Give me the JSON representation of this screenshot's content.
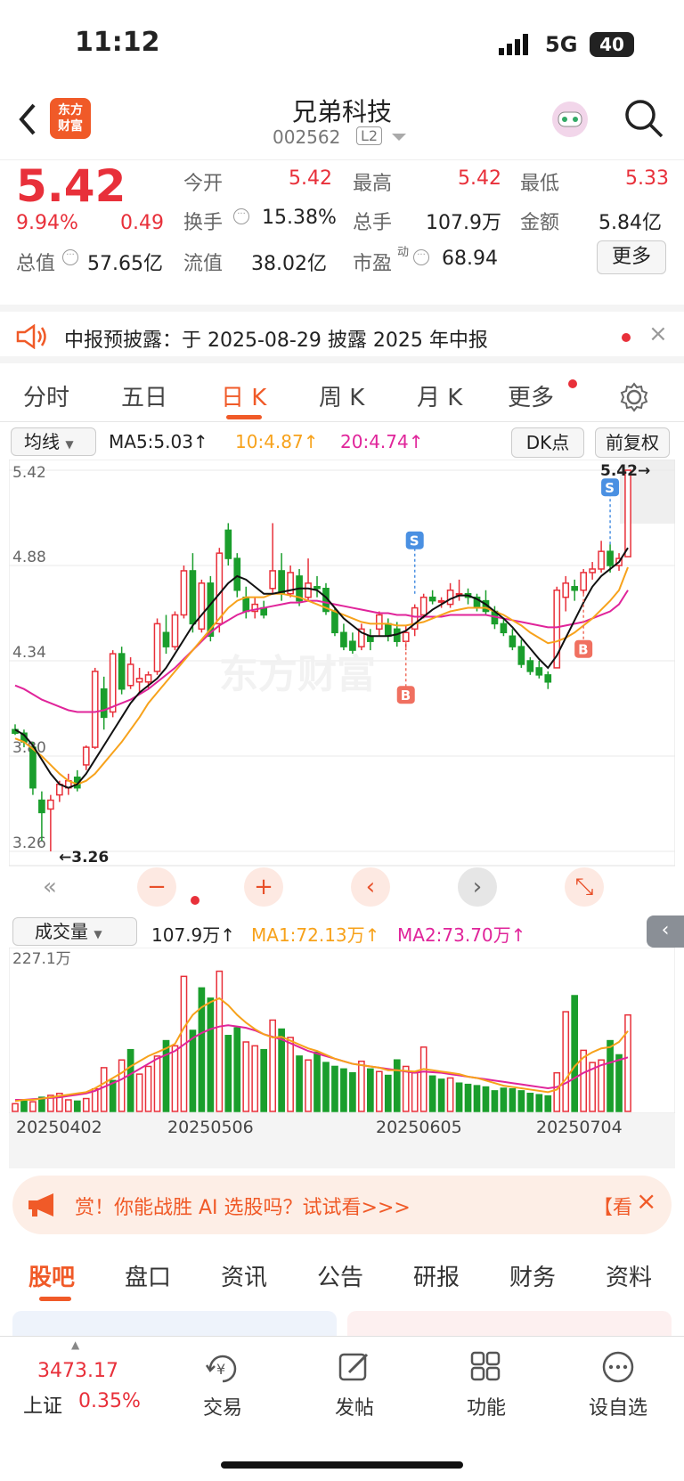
{
  "status_bar": {
    "time": "11:12",
    "network": "5G",
    "battery": "40"
  },
  "header": {
    "logo_line1": "东方",
    "logo_line2": "财富",
    "stock_name": "兄弟科技",
    "stock_code": "002562",
    "level_badge": "L2"
  },
  "quote": {
    "price": "5.42",
    "change_pct": "9.94%",
    "change": "0.49",
    "open_label": "今开",
    "open": "5.42",
    "high_label": "最高",
    "high": "5.42",
    "low_label": "最低",
    "low": "5.33",
    "turnover_label": "换手",
    "turnover": "15.38%",
    "volume_label": "总手",
    "volume": "107.9万",
    "amount_label": "金额",
    "amount": "5.84亿",
    "mktcap_label": "总值",
    "mktcap": "57.65亿",
    "float_label": "流值",
    "float": "38.02亿",
    "pe_label": "市盈",
    "pe_sup": "动",
    "pe": "68.94",
    "more_button": "更多"
  },
  "notice": {
    "text": "中报预披露：于 2025-08-29 披露 2025 年中报"
  },
  "period_tabs": [
    "分时",
    "五日",
    "日 K",
    "周 K",
    "月 K",
    "更多"
  ],
  "active_tab": "日 K",
  "indicator_bar": {
    "dropdown": "均线",
    "ma5": "MA5:5.03↑",
    "ma10": "10:4.87↑",
    "ma20": "20:4.74↑",
    "dk_button": "DK点",
    "fq_button": "前复权"
  },
  "chart_data": {
    "type": "candlestick",
    "y_ticks": [
      "5.42",
      "4.88",
      "4.34",
      "3.80",
      "3.26"
    ],
    "ylim": [
      3.26,
      5.42
    ],
    "max_label": "5.42→",
    "min_label": "←3.26",
    "watermark": "东方财富",
    "signals": [
      "S",
      "S",
      "B",
      "B"
    ],
    "candles": [
      [
        3.95,
        3.98,
        3.92,
        3.93
      ],
      [
        3.93,
        3.95,
        3.85,
        3.88
      ],
      [
        3.85,
        3.88,
        3.58,
        3.62
      ],
      [
        3.55,
        3.6,
        3.32,
        3.48
      ],
      [
        3.5,
        3.58,
        3.26,
        3.55
      ],
      [
        3.58,
        3.66,
        3.54,
        3.64
      ],
      [
        3.62,
        3.7,
        3.58,
        3.66
      ],
      [
        3.68,
        3.72,
        3.6,
        3.62
      ],
      [
        3.75,
        3.86,
        3.72,
        3.85
      ],
      [
        3.85,
        4.3,
        3.84,
        4.28
      ],
      [
        4.18,
        4.25,
        3.95,
        4.02
      ],
      [
        4.05,
        4.4,
        4.02,
        4.38
      ],
      [
        4.38,
        4.42,
        4.15,
        4.18
      ],
      [
        4.2,
        4.36,
        4.18,
        4.32
      ],
      [
        4.22,
        4.3,
        4.16,
        4.24
      ],
      [
        4.22,
        4.28,
        4.18,
        4.26
      ],
      [
        4.28,
        4.58,
        4.26,
        4.55
      ],
      [
        4.5,
        4.6,
        4.38,
        4.42
      ],
      [
        4.42,
        4.62,
        4.4,
        4.6
      ],
      [
        4.6,
        4.88,
        4.58,
        4.85
      ],
      [
        4.85,
        4.95,
        4.5,
        4.55
      ],
      [
        4.52,
        4.8,
        4.5,
        4.78
      ],
      [
        4.78,
        4.82,
        4.45,
        4.48
      ],
      [
        4.55,
        4.98,
        4.5,
        4.95
      ],
      [
        5.08,
        5.12,
        4.88,
        4.92
      ],
      [
        4.92,
        4.95,
        4.7,
        4.74
      ],
      [
        4.7,
        4.76,
        4.58,
        4.62
      ],
      [
        4.62,
        4.7,
        4.58,
        4.66
      ],
      [
        4.64,
        4.68,
        4.58,
        4.6
      ],
      [
        4.75,
        5.12,
        4.72,
        4.85
      ],
      [
        4.85,
        4.95,
        4.68,
        4.72
      ],
      [
        4.72,
        4.88,
        4.7,
        4.84
      ],
      [
        4.82,
        4.86,
        4.65,
        4.68
      ],
      [
        4.7,
        4.92,
        4.68,
        4.78
      ],
      [
        4.76,
        4.82,
        4.7,
        4.75
      ],
      [
        4.75,
        4.78,
        4.6,
        4.62
      ],
      [
        4.62,
        4.64,
        4.48,
        4.5
      ],
      [
        4.5,
        4.55,
        4.4,
        4.42
      ],
      [
        4.45,
        4.5,
        4.38,
        4.4
      ],
      [
        4.42,
        4.55,
        4.4,
        4.52
      ],
      [
        4.48,
        4.52,
        4.4,
        4.45
      ],
      [
        4.52,
        4.62,
        4.48,
        4.6
      ],
      [
        4.55,
        4.58,
        4.45,
        4.48
      ],
      [
        4.52,
        4.56,
        4.42,
        4.45
      ],
      [
        4.45,
        4.54,
        4.4,
        4.5
      ],
      [
        4.52,
        4.66,
        4.48,
        4.64
      ],
      [
        4.6,
        4.72,
        4.58,
        4.7
      ],
      [
        4.7,
        4.74,
        4.66,
        4.68
      ],
      [
        4.68,
        4.7,
        4.64,
        4.68
      ],
      [
        4.66,
        4.78,
        4.64,
        4.74
      ],
      [
        4.72,
        4.8,
        4.68,
        4.72
      ],
      [
        4.72,
        4.75,
        4.66,
        4.7
      ],
      [
        4.7,
        4.72,
        4.62,
        4.64
      ],
      [
        4.68,
        4.74,
        4.6,
        4.62
      ],
      [
        4.62,
        4.65,
        4.52,
        4.55
      ],
      [
        4.55,
        4.58,
        4.48,
        4.5
      ],
      [
        4.48,
        4.52,
        4.4,
        4.42
      ],
      [
        4.42,
        4.46,
        4.3,
        4.32
      ],
      [
        4.34,
        4.36,
        4.26,
        4.28
      ],
      [
        4.3,
        4.34,
        4.24,
        4.26
      ],
      [
        4.26,
        4.28,
        4.18,
        4.22
      ],
      [
        4.3,
        4.76,
        4.3,
        4.74
      ],
      [
        4.7,
        4.82,
        4.62,
        4.78
      ],
      [
        4.76,
        4.8,
        4.68,
        4.74
      ],
      [
        4.74,
        4.86,
        4.72,
        4.84
      ],
      [
        4.84,
        4.9,
        4.8,
        4.86
      ],
      [
        4.86,
        5.02,
        4.84,
        4.96
      ],
      [
        4.96,
        5.0,
        4.84,
        4.88
      ],
      [
        4.88,
        4.95,
        4.85,
        4.92
      ],
      [
        4.93,
        5.42,
        4.93,
        5.42
      ]
    ],
    "ma5": [
      3.95,
      3.9,
      3.8,
      3.72,
      3.64,
      3.6,
      3.59,
      3.62,
      3.7,
      3.82,
      3.9,
      3.98,
      4.06,
      4.18,
      4.22,
      4.24,
      4.28,
      4.34,
      4.4,
      4.5,
      4.56,
      4.62,
      4.7,
      4.74,
      4.8,
      4.82,
      4.76,
      4.72,
      4.68,
      4.7,
      4.72,
      4.74,
      4.76,
      4.76,
      4.76,
      4.72,
      4.65,
      4.6,
      4.55,
      4.5,
      4.47,
      4.46,
      4.48,
      4.48,
      4.5,
      4.54,
      4.58,
      4.62,
      4.66,
      4.7,
      4.71,
      4.72,
      4.7,
      4.68,
      4.64,
      4.6,
      4.55,
      4.48,
      4.42,
      4.36,
      4.3,
      4.36,
      4.46,
      4.56,
      4.66,
      4.78,
      4.84,
      4.86,
      4.88,
      5.03
    ],
    "ma10": [
      3.9,
      3.88,
      3.84,
      3.8,
      3.75,
      3.7,
      3.66,
      3.64,
      3.66,
      3.7,
      3.76,
      3.82,
      3.88,
      3.95,
      4.02,
      4.1,
      4.16,
      4.22,
      4.28,
      4.34,
      4.4,
      4.46,
      4.52,
      4.58,
      4.64,
      4.68,
      4.7,
      4.7,
      4.7,
      4.72,
      4.72,
      4.71,
      4.7,
      4.68,
      4.66,
      4.64,
      4.62,
      4.6,
      4.58,
      4.56,
      4.55,
      4.55,
      4.55,
      4.54,
      4.54,
      4.55,
      4.56,
      4.58,
      4.6,
      4.62,
      4.63,
      4.64,
      4.64,
      4.64,
      4.62,
      4.6,
      4.57,
      4.54,
      4.5,
      4.47,
      4.44,
      4.45,
      4.47,
      4.5,
      4.54,
      4.58,
      4.63,
      4.68,
      4.74,
      4.87
    ],
    "ma20": [
      4.2,
      4.18,
      4.15,
      4.12,
      4.1,
      4.08,
      4.06,
      4.05,
      4.05,
      4.05,
      4.06,
      4.08,
      4.1,
      4.12,
      4.15,
      4.18,
      4.22,
      4.26,
      4.3,
      4.35,
      4.4,
      4.45,
      4.5,
      4.54,
      4.57,
      4.6,
      4.62,
      4.63,
      4.64,
      4.65,
      4.66,
      4.67,
      4.67,
      4.68,
      4.68,
      4.67,
      4.66,
      4.65,
      4.64,
      4.63,
      4.62,
      4.61,
      4.61,
      4.6,
      4.6,
      4.59,
      4.59,
      4.59,
      4.59,
      4.6,
      4.6,
      4.6,
      4.6,
      4.6,
      4.59,
      4.58,
      4.57,
      4.56,
      4.55,
      4.54,
      4.53,
      4.53,
      4.54,
      4.55,
      4.56,
      4.58,
      4.6,
      4.62,
      4.66,
      4.74
    ],
    "ma9": [
      3.95,
      3.92,
      3.86,
      3.78,
      3.7,
      3.64,
      3.62,
      3.64,
      3.7,
      3.78,
      3.86,
      3.94,
      4.02,
      4.1,
      4.16,
      4.2,
      4.24,
      4.3,
      4.38,
      4.46,
      4.54,
      4.6,
      4.66,
      4.72,
      4.78,
      4.82,
      4.8,
      4.76,
      4.72,
      4.72,
      4.73,
      4.74,
      4.75,
      4.75,
      4.74,
      4.7,
      4.64,
      4.58,
      4.54,
      4.5,
      4.48,
      4.48,
      4.48,
      4.49,
      4.51,
      4.55,
      4.59,
      4.63,
      4.66,
      4.69,
      4.71,
      4.71,
      4.69,
      4.66,
      4.62,
      4.58,
      4.53,
      4.47,
      4.41,
      4.35,
      4.3,
      4.37,
      4.47,
      4.57,
      4.67,
      4.76,
      4.82,
      4.86,
      4.9,
      4.98
    ]
  },
  "controls": {
    "prev": "‹",
    "next": "›",
    "minus": "−",
    "plus": "+",
    "rewind": "«"
  },
  "volume_bar": {
    "dropdown": "成交量",
    "vol": "107.9万↑",
    "ma1": "MA1:72.13万↑",
    "ma2": "MA2:73.70万↑",
    "max_label": "227.1万"
  },
  "volume_data": {
    "values": [
      12,
      18,
      15,
      22,
      25,
      28,
      18,
      16,
      20,
      35,
      68,
      48,
      80,
      96,
      58,
      70,
      86,
      110,
      102,
      210,
      126,
      192,
      176,
      218,
      118,
      130,
      108,
      102,
      96,
      142,
      128,
      115,
      86,
      80,
      92,
      76,
      70,
      66,
      60,
      78,
      66,
      62,
      56,
      80,
      70,
      60,
      100,
      55,
      50,
      52,
      44,
      42,
      40,
      38,
      32,
      36,
      35,
      32,
      28,
      26,
      24,
      60,
      155,
      180,
      95,
      76,
      80,
      110,
      88,
      150
    ],
    "up": [
      true,
      false,
      true,
      false,
      true,
      true,
      true,
      false,
      true,
      true,
      true,
      false,
      true,
      false,
      true,
      true,
      true,
      false,
      true,
      true,
      false,
      false,
      false,
      true,
      false,
      false,
      true,
      true,
      false,
      true,
      false,
      true,
      false,
      true,
      false,
      false,
      false,
      false,
      false,
      true,
      false,
      true,
      false,
      false,
      true,
      true,
      true,
      false,
      false,
      true,
      false,
      false,
      false,
      false,
      false,
      false,
      false,
      false,
      false,
      false,
      false,
      true,
      true,
      false,
      true,
      true,
      true,
      false,
      false,
      true
    ],
    "ma1": [
      16,
      18,
      18,
      20,
      22,
      24,
      26,
      28,
      30,
      36,
      44,
      52,
      60,
      70,
      78,
      86,
      92,
      98,
      105,
      130,
      150,
      162,
      170,
      176,
      165,
      150,
      138,
      128,
      120,
      115,
      116,
      110,
      104,
      98,
      94,
      88,
      82,
      78,
      74,
      72,
      70,
      68,
      64,
      64,
      63,
      62,
      66,
      64,
      62,
      60,
      58,
      54,
      52,
      48,
      44,
      40,
      38,
      36,
      34,
      32,
      30,
      34,
      50,
      70,
      84,
      92,
      98,
      100,
      108,
      125
    ],
    "ma2": [
      18,
      18,
      19,
      20,
      21,
      22,
      24,
      26,
      28,
      32,
      38,
      44,
      50,
      58,
      66,
      74,
      82,
      88,
      94,
      104,
      114,
      122,
      128,
      132,
      134,
      132,
      130,
      126,
      120,
      116,
      112,
      106,
      100,
      94,
      90,
      86,
      82,
      78,
      74,
      72,
      70,
      68,
      66,
      64,
      62,
      60,
      62,
      61,
      60,
      58,
      56,
      54,
      52,
      50,
      48,
      46,
      44,
      42,
      40,
      38,
      36,
      38,
      44,
      52,
      60,
      66,
      72,
      76,
      80,
      84
    ]
  },
  "x_labels": [
    "20250402",
    "20250506",
    "20250605",
    "20250704"
  ],
  "banner": {
    "text": "赏！你能战胜 AI 选股吗？试试看>>>",
    "tail": "【看"
  },
  "sub_tabs": [
    "股吧",
    "盘口",
    "资讯",
    "公告",
    "研报",
    "财务",
    "资料"
  ],
  "bottom_bar": {
    "index_value": "3473.17",
    "index_name": "上证",
    "index_change": "0.35%",
    "items": [
      "交易",
      "发帖",
      "功能",
      "设自选"
    ]
  },
  "colors": {
    "up": "#e8303a",
    "down": "#1a9e2c",
    "ma5": "#111111",
    "ma10": "#f7a21b",
    "ma20": "#e0249a",
    "accent": "#f05a28"
  }
}
